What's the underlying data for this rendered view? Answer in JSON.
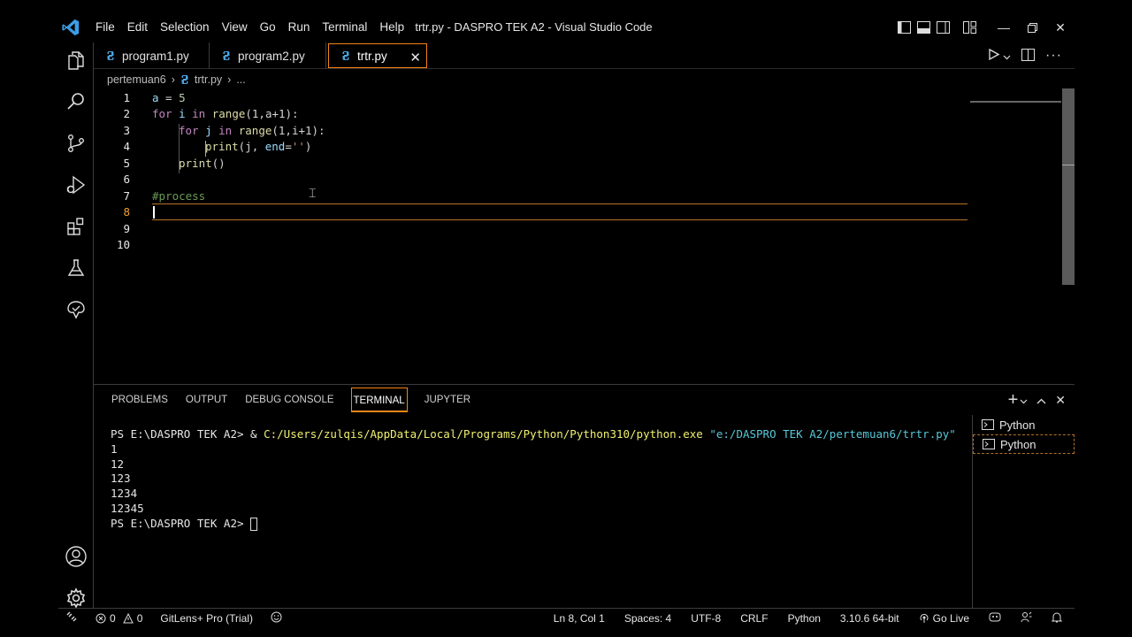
{
  "menu": [
    "File",
    "Edit",
    "Selection",
    "View",
    "Go",
    "Run",
    "Terminal",
    "Help"
  ],
  "window_title": "trtr.py - DASPRO TEK A2 - Visual Studio Code",
  "tabs": [
    {
      "label": "program1.py"
    },
    {
      "label": "program2.py"
    },
    {
      "label": "trtr.py"
    }
  ],
  "breadcrumb": {
    "folder": "pertemuan6",
    "file": "trtr.py",
    "more": "..."
  },
  "editor": {
    "line_numbers": [
      "1",
      "2",
      "3",
      "4",
      "5",
      "6",
      "7",
      "8",
      "9",
      "10"
    ],
    "current_line": "8",
    "lines": {
      "l1": {
        "a": "a",
        "eq": " = ",
        "n": "5"
      },
      "l2": {
        "for": "for",
        "i": " i ",
        "in": "in",
        "range": " range",
        "args": "(1,a+1):"
      },
      "l3": {
        "for": "for",
        "j": " j ",
        "in": "in",
        "range": " range",
        "args": "(1,i+1):"
      },
      "l4": {
        "print": "print",
        "p1": "(j, ",
        "end": "end",
        "p2": "=",
        "str": "''",
        "p3": ")"
      },
      "l5": {
        "print": "print",
        "p": "()"
      },
      "l7": {
        "comment": "#process"
      }
    }
  },
  "panel": {
    "tabs": [
      "PROBLEMS",
      "OUTPUT",
      "DEBUG CONSOLE",
      "TERMINAL",
      "JUPYTER"
    ],
    "terminal": {
      "prompt": "PS E:\\DASPRO TEK A2> ",
      "amp": "& ",
      "exe": "C:/Users/zulqis/AppData/Local/Programs/Python/Python310/python.exe",
      "arg": "\"e:/DASPRO TEK A2/pertemuan6/trtr.py\"",
      "output": [
        "1",
        "12",
        "123",
        "1234",
        "12345"
      ],
      "prompt2": "PS E:\\DASPRO TEK A2> "
    },
    "terminal_list": [
      "Python",
      "Python"
    ]
  },
  "statusbar": {
    "errors": "0",
    "warnings": "0",
    "gitlens": "GitLens+ Pro (Trial)",
    "position": "Ln 8, Col 1",
    "spaces": "Spaces: 4",
    "encoding": "UTF-8",
    "eol": "CRLF",
    "language": "Python",
    "interpreter": "3.10.6 64-bit",
    "golive": "Go Live"
  },
  "colors": {
    "accent_border": "#f38518",
    "vscode_blue": "#3b9de6",
    "python_blue": "#4aa3df"
  }
}
